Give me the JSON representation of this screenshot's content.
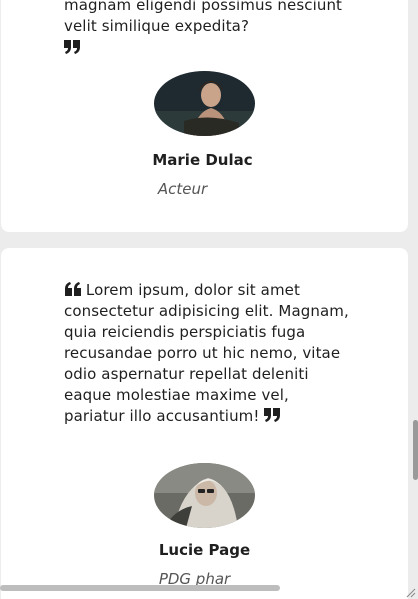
{
  "testimonials": [
    {
      "quote": "magnam eligendi possimus nesciunt velit similique expedita?",
      "name": "Marie Dulac",
      "role": "Acteur"
    },
    {
      "quote": "Lorem ipsum, dolor sit amet consectetur adipisicing elit. Magnam, quia reiciendis perspiciatis fuga recusandae porro ut hic nemo, vitae odio aspernatur repellat deleniti eaque molestiae maxime vel, pariatur illo accusantium!",
      "name": "Lucie Page",
      "role": "PDG phar"
    }
  ],
  "icons": {
    "open_quote": "quote-open-icon",
    "close_quote": "quote-close-icon"
  },
  "colors": {
    "background": "#ececec",
    "card": "#ffffff",
    "text": "#1f1f1f",
    "role_text": "#555555"
  }
}
